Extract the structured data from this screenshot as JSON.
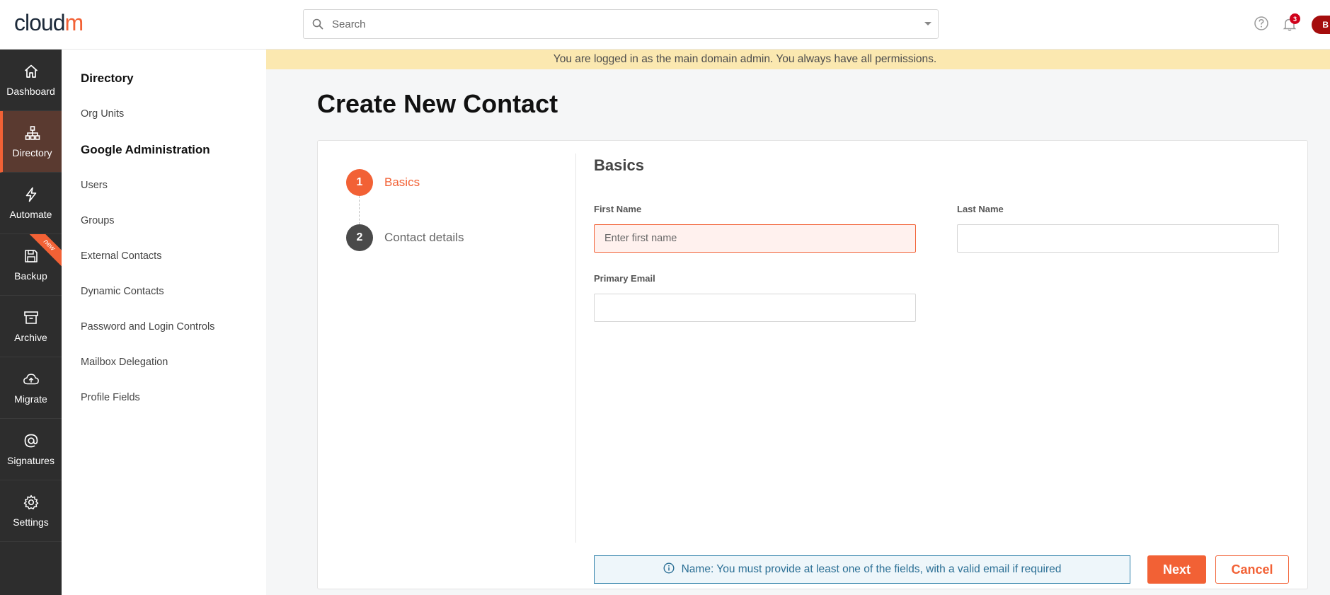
{
  "brand": {
    "logo_part1": "cloud",
    "logo_part2": "m",
    "accent_color": "#f26135"
  },
  "header": {
    "search_placeholder": "Search",
    "notification_count": "3",
    "avatar_initial": "B"
  },
  "leftnav": {
    "items": [
      {
        "label": "Dashboard",
        "icon": "home-icon"
      },
      {
        "label": "Directory",
        "icon": "org-chart-icon",
        "active": true
      },
      {
        "label": "Automate",
        "icon": "lightning-icon"
      },
      {
        "label": "Backup",
        "icon": "save-icon",
        "ribbon": "new"
      },
      {
        "label": "Archive",
        "icon": "archive-box-icon"
      },
      {
        "label": "Migrate",
        "icon": "cloud-upload-icon"
      },
      {
        "label": "Signatures",
        "icon": "at-sign-icon"
      },
      {
        "label": "Settings",
        "icon": "gear-icon"
      }
    ]
  },
  "subnav": {
    "section1_title": "Directory",
    "section1_items": [
      "Org Units"
    ],
    "section2_title": "Google Administration",
    "section2_items": [
      "Users",
      "Groups",
      "External Contacts",
      "Dynamic Contacts",
      "Password and Login Controls",
      "Mailbox Delegation",
      "Profile Fields"
    ]
  },
  "banner": {
    "text": "You are logged in as the main domain admin. You always have all permissions."
  },
  "page": {
    "title": "Create New Contact"
  },
  "wizard": {
    "steps": [
      {
        "number": "1",
        "label": "Basics",
        "state": "active"
      },
      {
        "number": "2",
        "label": "Contact details",
        "state": "inactive"
      }
    ]
  },
  "form": {
    "title": "Basics",
    "first_name_label": "First Name",
    "first_name_placeholder": "Enter first name",
    "first_name_value": "",
    "last_name_label": "Last Name",
    "last_name_value": "",
    "primary_email_label": "Primary Email",
    "primary_email_value": ""
  },
  "alert": {
    "text": "Name: You must provide at least one of the fields, with a valid email if required"
  },
  "actions": {
    "next_label": "Next",
    "cancel_label": "Cancel"
  }
}
